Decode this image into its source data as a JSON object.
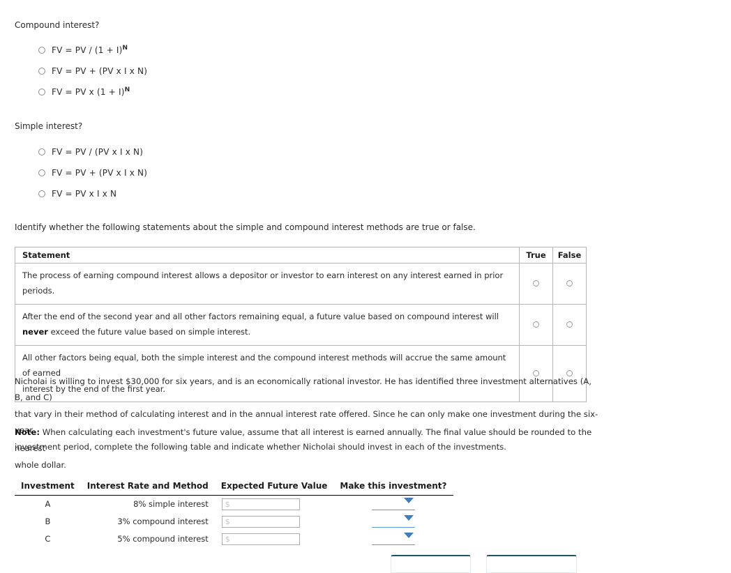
{
  "questions": [
    {
      "prompt": "Compound interest?",
      "options": [
        {
          "text": "FV = PV / (1 + I)",
          "sup": "N"
        },
        {
          "text": "FV = PV + (PV x I x N)",
          "sup": ""
        },
        {
          "text": "FV = PV x (1 + I)",
          "sup": "N"
        }
      ]
    },
    {
      "prompt": "Simple interest?",
      "options": [
        {
          "text": "FV = PV / (PV x I x N)",
          "sup": ""
        },
        {
          "text": "FV = PV + (PV x I x N)",
          "sup": ""
        },
        {
          "text": "FV = PV x I x N",
          "sup": ""
        }
      ]
    }
  ],
  "instruction": "Identify whether the following statements about the simple and compound interest methods are true or false.",
  "tf_table": {
    "headers": {
      "statement": "Statement",
      "true": "True",
      "false": "False"
    },
    "rows": [
      {
        "line1": "The process of earning compound interest allows a depositor or investor to earn interest on any interest earned in prior periods.",
        "line2_pre": "",
        "line2_bold": "",
        "line2_post": ""
      },
      {
        "line1": "After the end of the second year and all other factors remaining equal, a future value based on compound interest will",
        "line2_pre": "",
        "line2_bold": "never",
        "line2_post": " exceed the future value based on simple interest."
      },
      {
        "line1": "All other factors being equal, both the simple interest and the compound interest methods will accrue the same amount of earned",
        "line2_pre": "interest by the end of the first year.",
        "line2_bold": "",
        "line2_post": ""
      }
    ]
  },
  "scenario": {
    "line1": "Nicholai is willing to invest $30,000 for six years, and is an economically rational investor. He has identified three investment alternatives (A, B, and C)",
    "line2": "that vary in their method of calculating interest and in the annual interest rate offered. Since he can only make one investment during the six-year",
    "line3": "investment period, complete the following table and indicate whether Nicholai should invest in each of the investments."
  },
  "note": {
    "label": "Note:",
    "line1": " When calculating each investment's future value, assume that all interest is earned annually. The final value should be rounded to the nearest",
    "line2": "whole dollar."
  },
  "inv_table": {
    "headers": [
      "Investment",
      "Interest Rate and Method",
      "Expected Future Value",
      "Make this investment?"
    ],
    "rows": [
      {
        "investment": "A",
        "method": "8% simple interest",
        "fv_placeholder": "$",
        "fv_value": "",
        "decision": ""
      },
      {
        "investment": "B",
        "method": "3% compound interest",
        "fv_placeholder": "$",
        "fv_value": "",
        "decision": ""
      },
      {
        "investment": "C",
        "method": "5% compound interest",
        "fv_placeholder": "$",
        "fv_value": "",
        "decision": ""
      }
    ]
  },
  "colors": {
    "accent_blue": "#5b9bd5",
    "arrow_blue": "#3d7ebb",
    "button_border": "#1f5468",
    "table_border": "#b6b6b6"
  }
}
